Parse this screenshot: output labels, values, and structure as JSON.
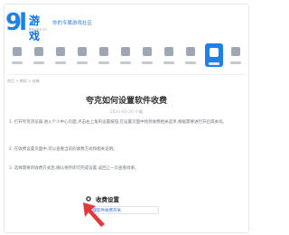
{
  "header": {
    "logo_number": "9l",
    "logo_text": "游戏",
    "logo_sub": "9game.cn",
    "slogan": "你的专属游戏社区"
  },
  "nav": {
    "items": [
      {
        "icon": "home-icon"
      },
      {
        "icon": "gamepad-icon"
      },
      {
        "icon": "grid-icon"
      },
      {
        "icon": "android-icon"
      },
      {
        "icon": "apple-icon"
      },
      {
        "icon": "gift-icon"
      },
      {
        "icon": "chart-icon"
      },
      {
        "icon": "news-icon"
      },
      {
        "icon": "trophy-icon"
      },
      {
        "icon": "book-icon",
        "active": true
      },
      {
        "icon": "user-icon"
      }
    ]
  },
  "breadcrumb": "首页 > 教程 > 攻略",
  "article": {
    "title": "夸克如何设置软件收费",
    "meta": "2024-05-20   小编",
    "p1": "1. 打开夸克浏览器,进入个人中心页面,点击右上角的设置按钮,在设置页面中找到收费相关选项,根据需要进行开启或关闭。",
    "p2": "2. 在收费设置页面中,可以查看当前的收费方式和相关说明。",
    "p3": "3. 选择需要的收费方式后,确认保存即可完成设置,返回上一页查看效果。"
  },
  "settings_card": {
    "title": "收费设置",
    "row_label": "管理软件收费开关"
  },
  "colors": {
    "brand": "#1f80ea",
    "arrow": "#e23a3a"
  }
}
